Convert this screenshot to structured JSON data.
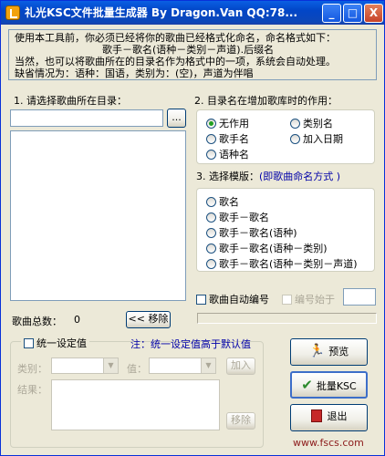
{
  "window": {
    "title": "礼光KSC文件批量生成器 By Dragon.Van   QQ:78...",
    "controls": [
      "_",
      "□",
      "X"
    ]
  },
  "info": {
    "line1": "使用本工具前，你必须已经将你的歌曲已经格式化命名，命名格式如下：",
    "line2": "歌手－歌名(语种－类别－声道).后缀名",
    "line3": "当然，也可以将歌曲所在的目录名作为格式中的一项，系统会自动处理。",
    "line4": "缺省情况为：语种：国语，类别为：(空)，声道为伴唱"
  },
  "step1": {
    "label": "1. 请选择歌曲所在目录：",
    "path_value": "",
    "browse": "..."
  },
  "step2": {
    "label": "2. 目录名在增加歌库时的作用：",
    "options": [
      {
        "label": "无作用",
        "selected": true
      },
      {
        "label": "类别名",
        "selected": false
      },
      {
        "label": "歌手名",
        "selected": false
      },
      {
        "label": "加入日期",
        "selected": false
      },
      {
        "label": "语种名",
        "selected": false
      }
    ]
  },
  "step3": {
    "label": "3. 选择模版：",
    "hint": "(即歌曲命名方式 )",
    "options": [
      {
        "label": "歌名",
        "selected": false
      },
      {
        "label": "歌手－歌名",
        "selected": false
      },
      {
        "label": "歌手－歌名(语种)",
        "selected": false
      },
      {
        "label": "歌手－歌名(语种－类别)",
        "selected": false
      },
      {
        "label": "歌手－歌名(语种－类别－声道)",
        "selected": false
      }
    ]
  },
  "auto_number": {
    "label": "歌曲自动编号",
    "start_label": "编号始于",
    "start_value": ""
  },
  "total": {
    "label": "歌曲总数：",
    "value": "0",
    "remove_btn": "<< 移除"
  },
  "unify": {
    "label": "统一设定值",
    "note": "注：统一设定值高于默认值",
    "category_label": "类别：",
    "value_label": "值：",
    "add_btn": "加入",
    "result_label": "结果：",
    "remove_btn": "移除"
  },
  "actions": {
    "preview": "预览",
    "batch": "批量KSC",
    "exit": "退出"
  },
  "watermark": "www.fscs.com",
  "colors": {
    "title_bar": "#0A5FE3",
    "note_blue": "#0000A8",
    "preview_icon": "#1E9E2A",
    "check_icon": "#2E8B2E",
    "exit_icon": "#C62828"
  }
}
